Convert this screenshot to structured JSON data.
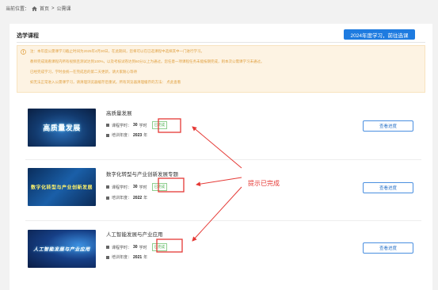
{
  "breadcrumb": {
    "label": "当前位置：",
    "home": "首页",
    "sep": ">",
    "current": "公需课"
  },
  "section_title": "选学课程",
  "select_button": "2024年度学习，前往选课",
  "notice_lines": [
    "注：本年度公需课学习截止时间为2025年4月30日，在此期间，您将可以在已选课程中选择其中一门进行学习。",
    "教师完成观看课程内所有视频且测试达到100%，以及考核试卷达到60分以上为通过。您任意一项课程任务未能按期完成，则本次公需课学习未通过。",
    "已经完成学习，学时会统一在完成后的第二天更新，请大家耐心等待",
    "如无法正常进入公需课学习，请清理浏览器缓存后重试。所有浏览器清理缓存的方法： 点此查看"
  ],
  "courses": [
    {
      "title": "高质量发展",
      "hours_label": "课程学时：",
      "hours": "30",
      "hours_unit": "学时",
      "status": "已完成",
      "year_label": "培训年度：",
      "year": "2023",
      "year_unit": "年",
      "thumb_text": "高质量发展",
      "button": "查看进度"
    },
    {
      "title": "数字化转型与产业创新发展专题",
      "hours_label": "课程学时：",
      "hours": "30",
      "hours_unit": "学时",
      "status": "已完成",
      "year_label": "培训年度：",
      "year": "2022",
      "year_unit": "年",
      "thumb_text": "数字化转型与产业创新发展",
      "button": "查看进度"
    },
    {
      "title": "人工智能发展与产业应用",
      "hours_label": "课程学时：",
      "hours": "30",
      "hours_unit": "学时",
      "status": "已完成",
      "year_label": "培训年度：",
      "year": "2021",
      "year_unit": "年",
      "thumb_text": "人工智能发展与产业应用",
      "button": "查看进度"
    }
  ],
  "annotation": "提示已完成",
  "colors": {
    "primary": "#1e7be0",
    "notice_bg": "#fdf3e3",
    "notice_text": "#e0a040",
    "done_green": "#4caf50",
    "annotation_red": "#e53935"
  },
  "icons": {
    "home": "home-icon",
    "notice": "warning-icon",
    "meta": "book-icon"
  }
}
